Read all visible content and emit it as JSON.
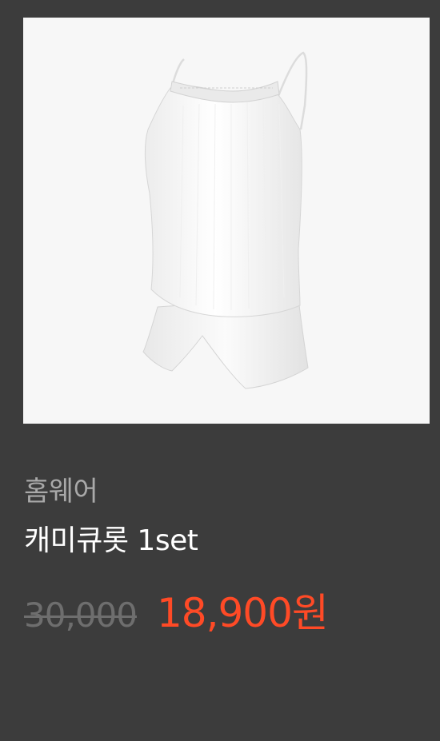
{
  "product": {
    "image_alt": "캐미큐롯 1set",
    "category": "홈웨어",
    "name": "캐미큐롯 1set",
    "original_price": "30,000",
    "sale_price": "18,900원"
  },
  "colors": {
    "background": "#3c3c3c",
    "image_background": "#f7f7f7",
    "category_text": "#a9a9a9",
    "name_text": "#ffffff",
    "original_price_text": "#6e6e6e",
    "sale_price_text": "#ff4a26"
  }
}
